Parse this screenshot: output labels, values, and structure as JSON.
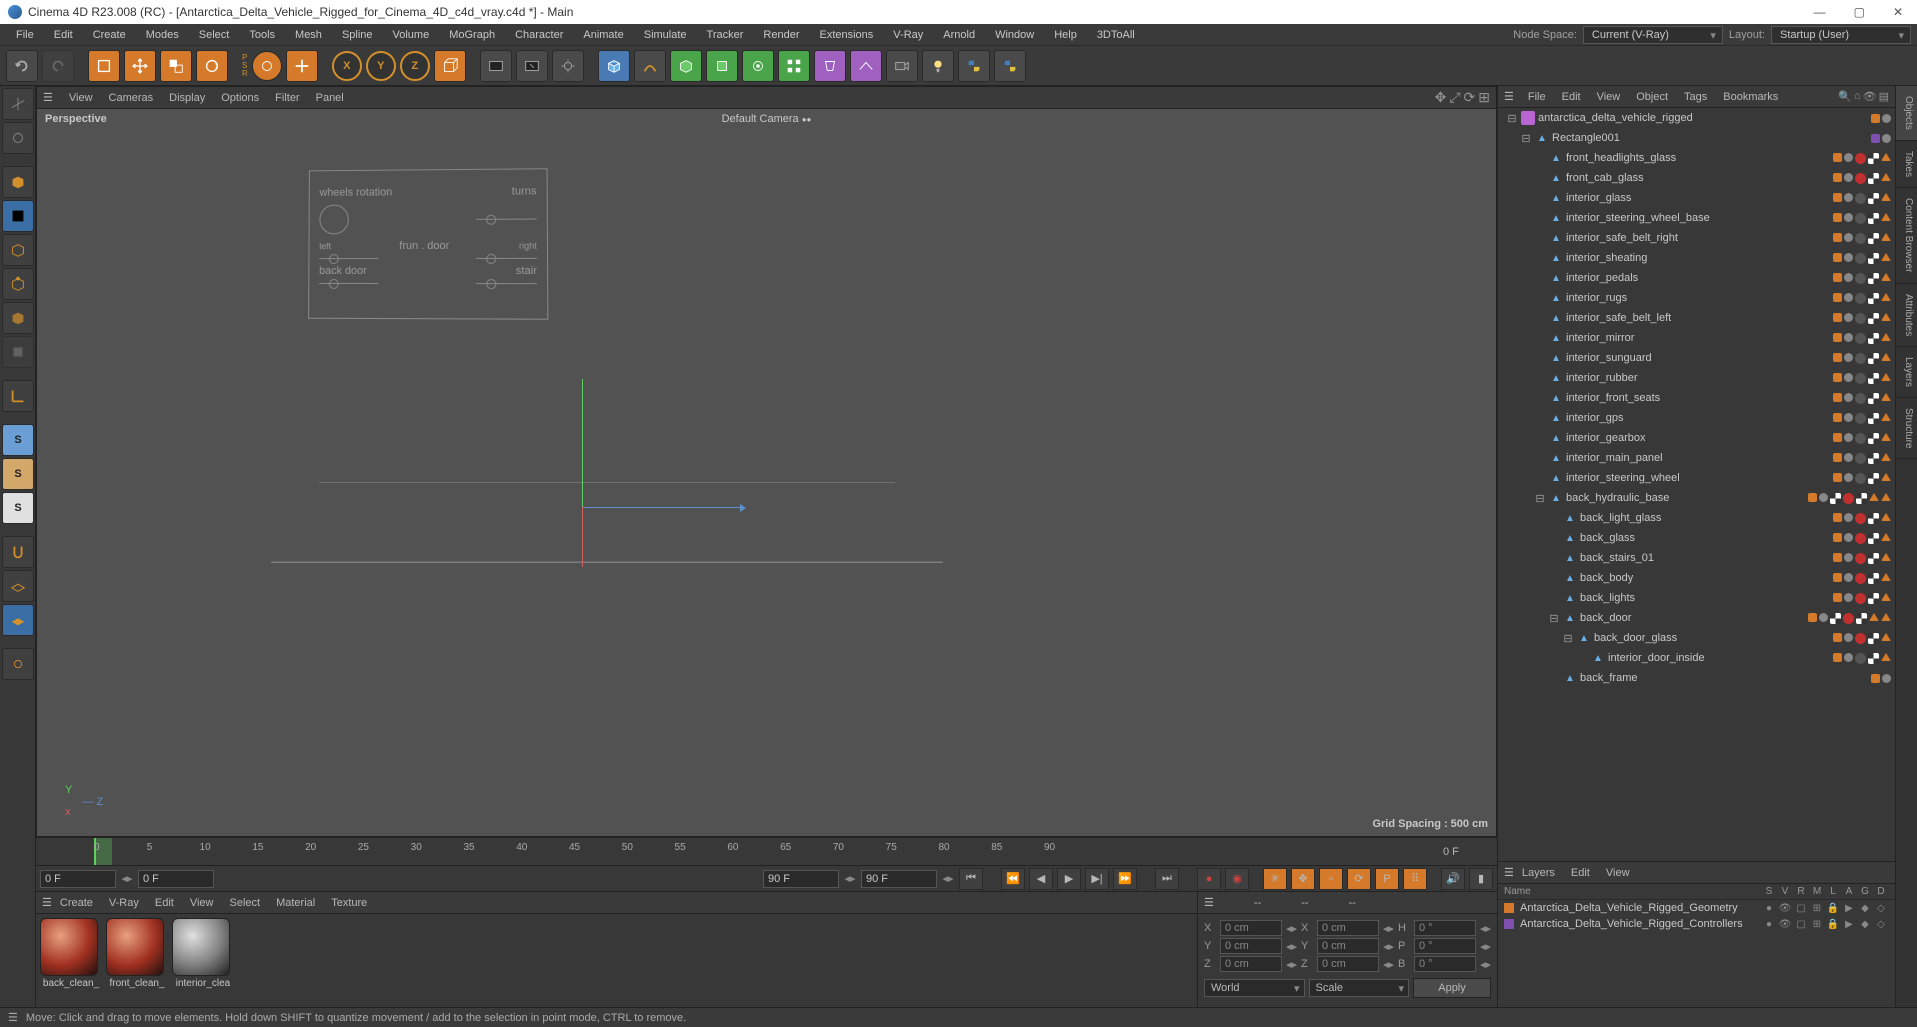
{
  "title": "Cinema 4D R23.008 (RC) - [Antarctica_Delta_Vehicle_Rigged_for_Cinema_4D_c4d_vray.c4d *] - Main",
  "menubar": [
    "File",
    "Edit",
    "Create",
    "Modes",
    "Select",
    "Tools",
    "Mesh",
    "Spline",
    "Volume",
    "MoGraph",
    "Character",
    "Animate",
    "Simulate",
    "Tracker",
    "Render",
    "Extensions",
    "V-Ray",
    "Arnold",
    "Window",
    "Help",
    "3DToAll"
  ],
  "node_space_label": "Node Space:",
  "node_space_value": "Current (V-Ray)",
  "layout_label": "Layout:",
  "layout_value": "Startup (User)",
  "viewport": {
    "menus": [
      "View",
      "Cameras",
      "Display",
      "Options",
      "Filter",
      "Panel"
    ],
    "label": "Perspective",
    "camera": "Default Camera",
    "grid": "Grid Spacing : 500 cm",
    "panel_labels": {
      "wheels": "wheels rotation",
      "turns": "turns",
      "left": "left",
      "right": "right",
      "front_door": "frun . door",
      "back_door": "back door",
      "stair": "stair"
    }
  },
  "timeline": {
    "ticks": [
      0,
      5,
      10,
      15,
      20,
      25,
      30,
      35,
      40,
      45,
      50,
      55,
      60,
      65,
      70,
      75,
      80,
      85,
      90
    ],
    "end": "0 F"
  },
  "playbar": {
    "start": "0 F",
    "cur": "0 F",
    "end1": "90 F",
    "end2": "90 F"
  },
  "materials": {
    "menus": [
      "Create",
      "V-Ray",
      "Edit",
      "View",
      "Select",
      "Material",
      "Texture"
    ],
    "items": [
      {
        "name": "back_clean_",
        "style": "red"
      },
      {
        "name": "front_clean_",
        "style": "red"
      },
      {
        "name": "interior_clea",
        "style": "grey"
      }
    ]
  },
  "coords": {
    "header": [
      "--",
      "--",
      "--"
    ],
    "rows": [
      {
        "l": "X",
        "a": "0 cm",
        "b": "X",
        "c": "0 cm",
        "d": "H",
        "e": "0 °"
      },
      {
        "l": "Y",
        "a": "0 cm",
        "b": "Y",
        "c": "0 cm",
        "d": "P",
        "e": "0 °"
      },
      {
        "l": "Z",
        "a": "0 cm",
        "b": "Z",
        "c": "0 cm",
        "d": "B",
        "e": "0 °"
      }
    ],
    "dd1": "World",
    "dd2": "Scale",
    "apply": "Apply"
  },
  "objects": {
    "menus": [
      "File",
      "Edit",
      "View",
      "Object",
      "Tags",
      "Bookmarks"
    ],
    "tree": [
      {
        "d": 0,
        "exp": "-",
        "type": "null",
        "name": "antarctica_delta_vehicle_rigged",
        "tags": [
          "orange",
          "grey"
        ]
      },
      {
        "d": 1,
        "exp": "-",
        "type": "poly",
        "name": "Rectangle001",
        "tags": [
          "purple",
          "grey"
        ]
      },
      {
        "d": 2,
        "exp": "",
        "type": "poly",
        "name": "front_headlights_glass",
        "tags": [
          "orange",
          "grey",
          "red",
          "check",
          "tri"
        ]
      },
      {
        "d": 2,
        "exp": "",
        "type": "poly",
        "name": "front_cab_glass",
        "tags": [
          "orange",
          "grey",
          "red",
          "check",
          "tri"
        ]
      },
      {
        "d": 2,
        "exp": "",
        "type": "poly",
        "name": "interior_glass",
        "tags": [
          "orange",
          "grey",
          "darkgrey",
          "check",
          "tri"
        ]
      },
      {
        "d": 2,
        "exp": "",
        "type": "poly",
        "name": "interior_steering_wheel_base",
        "tags": [
          "orange",
          "grey",
          "darkgrey",
          "check",
          "tri"
        ]
      },
      {
        "d": 2,
        "exp": "",
        "type": "poly",
        "name": "interior_safe_belt_right",
        "tags": [
          "orange",
          "grey",
          "darkgrey",
          "check",
          "tri"
        ]
      },
      {
        "d": 2,
        "exp": "",
        "type": "poly",
        "name": "interior_sheating",
        "tags": [
          "orange",
          "grey",
          "darkgrey",
          "check",
          "tri"
        ]
      },
      {
        "d": 2,
        "exp": "",
        "type": "poly",
        "name": "interior_pedals",
        "tags": [
          "orange",
          "grey",
          "darkgrey",
          "check",
          "tri"
        ]
      },
      {
        "d": 2,
        "exp": "",
        "type": "poly",
        "name": "interior_rugs",
        "tags": [
          "orange",
          "grey",
          "darkgrey",
          "check",
          "tri"
        ]
      },
      {
        "d": 2,
        "exp": "",
        "type": "poly",
        "name": "interior_safe_belt_left",
        "tags": [
          "orange",
          "grey",
          "darkgrey",
          "check",
          "tri"
        ]
      },
      {
        "d": 2,
        "exp": "",
        "type": "poly",
        "name": "interior_mirror",
        "tags": [
          "orange",
          "grey",
          "darkgrey",
          "check",
          "tri"
        ]
      },
      {
        "d": 2,
        "exp": "",
        "type": "poly",
        "name": "interior_sunguard",
        "tags": [
          "orange",
          "grey",
          "darkgrey",
          "check",
          "tri"
        ]
      },
      {
        "d": 2,
        "exp": "",
        "type": "poly",
        "name": "interior_rubber",
        "tags": [
          "orange",
          "grey",
          "darkgrey",
          "check",
          "tri"
        ]
      },
      {
        "d": 2,
        "exp": "",
        "type": "poly",
        "name": "interior_front_seats",
        "tags": [
          "orange",
          "grey",
          "darkgrey",
          "check",
          "tri"
        ]
      },
      {
        "d": 2,
        "exp": "",
        "type": "poly",
        "name": "interior_gps",
        "tags": [
          "orange",
          "grey",
          "darkgrey",
          "check",
          "tri"
        ]
      },
      {
        "d": 2,
        "exp": "",
        "type": "poly",
        "name": "interior_gearbox",
        "tags": [
          "orange",
          "grey",
          "darkgrey",
          "check",
          "tri"
        ]
      },
      {
        "d": 2,
        "exp": "",
        "type": "poly",
        "name": "interior_main_panel",
        "tags": [
          "orange",
          "grey",
          "darkgrey",
          "check",
          "tri"
        ]
      },
      {
        "d": 2,
        "exp": "",
        "type": "poly",
        "name": "interior_steering_wheel",
        "tags": [
          "orange",
          "grey",
          "darkgrey",
          "check",
          "tri"
        ]
      },
      {
        "d": 2,
        "exp": "-",
        "type": "poly",
        "name": "back_hydraulic_base",
        "tags": [
          "orange",
          "grey",
          "check",
          "red",
          "check",
          "tri",
          "tri"
        ]
      },
      {
        "d": 3,
        "exp": "",
        "type": "poly",
        "name": "back_light_glass",
        "tags": [
          "orange",
          "grey",
          "red",
          "check",
          "tri"
        ]
      },
      {
        "d": 3,
        "exp": "",
        "type": "poly",
        "name": "back_glass",
        "tags": [
          "orange",
          "grey",
          "red",
          "check",
          "tri"
        ]
      },
      {
        "d": 3,
        "exp": "",
        "type": "poly",
        "name": "back_stairs_01",
        "tags": [
          "orange",
          "grey",
          "red",
          "check",
          "tri"
        ]
      },
      {
        "d": 3,
        "exp": "",
        "type": "poly",
        "name": "back_body",
        "tags": [
          "orange",
          "grey",
          "red",
          "check",
          "tri"
        ]
      },
      {
        "d": 3,
        "exp": "",
        "type": "poly",
        "name": "back_lights",
        "tags": [
          "orange",
          "grey",
          "red",
          "check",
          "tri"
        ]
      },
      {
        "d": 3,
        "exp": "-",
        "type": "poly",
        "name": "back_door",
        "tags": [
          "orange",
          "grey",
          "check",
          "red",
          "check",
          "tri",
          "tri"
        ]
      },
      {
        "d": 4,
        "exp": "-",
        "type": "poly",
        "name": "back_door_glass",
        "tags": [
          "orange",
          "grey",
          "red",
          "check",
          "tri"
        ]
      },
      {
        "d": 5,
        "exp": "",
        "type": "poly",
        "name": "interior_door_inside",
        "tags": [
          "orange",
          "grey",
          "darkgrey",
          "check",
          "tri"
        ]
      },
      {
        "d": 3,
        "exp": "",
        "type": "poly",
        "name": "back_frame",
        "tags": [
          "orange",
          "grey"
        ]
      }
    ]
  },
  "layers": {
    "menus": [
      "Layers",
      "Edit",
      "View"
    ],
    "head_name": "Name",
    "head_cols": [
      "S",
      "V",
      "R",
      "M",
      "L",
      "A",
      "G",
      "D"
    ],
    "rows": [
      {
        "color": "#d47a2a",
        "name": "Antarctica_Delta_Vehicle_Rigged_Geometry"
      },
      {
        "color": "#8050b0",
        "name": "Antarctica_Delta_Vehicle_Rigged_Controllers"
      }
    ]
  },
  "side_tabs": [
    "Objects",
    "Takes",
    "Content Browser",
    "Attributes",
    "Layers",
    "Structure"
  ],
  "status": "Move: Click and drag to move elements. Hold down SHIFT to quantize movement / add to the selection in point mode, CTRL to remove."
}
